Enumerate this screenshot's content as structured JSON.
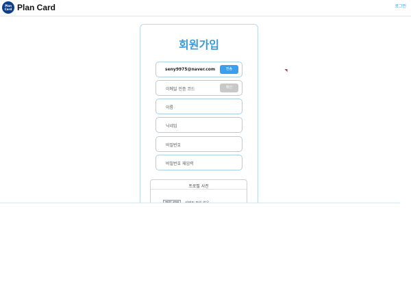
{
  "header": {
    "logo_badge_line1": "Plan",
    "logo_badge_line2": "Card",
    "logo_text": "Plan Card",
    "login_link": "로그인"
  },
  "signup": {
    "title": "회원가입",
    "email_value": "seny9975@naver.com",
    "send_button": "전송",
    "verify_placeholder": "이메일 인증 코드",
    "verify_button": "확인",
    "name_placeholder": "이름",
    "nickname_placeholder": "닉네임",
    "password_placeholder": "비밀번호",
    "password_confirm_placeholder": "비밀번호 재입력",
    "profile_label": "프로필 사진",
    "file_button": "파일 선택",
    "file_status": "선택된 파일 없음"
  },
  "colors": {
    "accent": "#3a9ad9",
    "button_blue": "#3b9ff0",
    "button_gray": "#c8c8c8",
    "field_border": "#a9cfe8",
    "logo_bg": "#0e3f8c"
  }
}
